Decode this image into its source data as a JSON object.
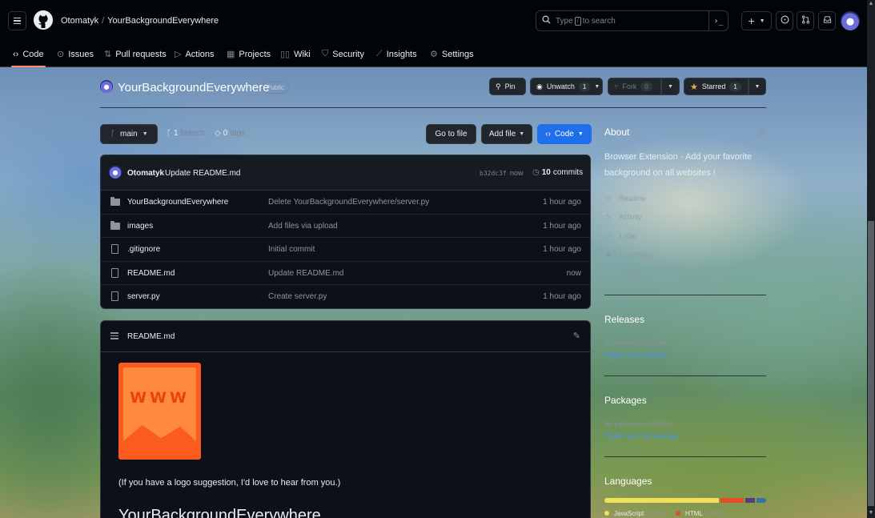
{
  "header": {
    "owner": "Otomatyk",
    "separator": "/",
    "repo": "YourBackgroundEverywhere",
    "search_prefix": "Type",
    "search_key": "/",
    "search_suffix": "to search",
    "cmd_symbol": "›_",
    "plus_symbol": "+"
  },
  "nav": {
    "tabs": [
      {
        "label": "Code",
        "icon": "code-icon"
      },
      {
        "label": "Issues",
        "icon": "issue-icon"
      },
      {
        "label": "Pull requests",
        "icon": "pull-request-icon"
      },
      {
        "label": "Actions",
        "icon": "play-icon"
      },
      {
        "label": "Projects",
        "icon": "table-icon"
      },
      {
        "label": "Wiki",
        "icon": "book-icon"
      },
      {
        "label": "Security",
        "icon": "shield-icon"
      },
      {
        "label": "Insights",
        "icon": "graph-icon"
      },
      {
        "label": "Settings",
        "icon": "gear-icon"
      }
    ],
    "active_tab": "Code",
    "accent_color": "#fd8c73"
  },
  "repo": {
    "title": "YourBackgroundEverywhere",
    "visibility": "Public",
    "pin_label": "Pin",
    "unwatch_label": "Unwatch",
    "unwatch_count": "1",
    "fork_label": "Fork",
    "fork_count": "0",
    "star_label": "Starred",
    "star_count": "1"
  },
  "branch": {
    "name": "main",
    "branch_count": "1",
    "branch_word": "branch",
    "tag_count": "0",
    "tag_word": "tags",
    "go_to_file": "Go to file",
    "add_file": "Add file",
    "code_label": "Code",
    "code_color": "#1f6feb"
  },
  "commit": {
    "author": "Otomatyk",
    "message": "Update README.md",
    "sha": "b32dc3f",
    "time": "now",
    "count": "10",
    "count_word": "commits"
  },
  "files": [
    {
      "name": "YourBackgroundEverywhere",
      "type": "folder",
      "message": "Delete YourBackgroundEverywhere/server.py",
      "time": "1 hour ago"
    },
    {
      "name": "images",
      "type": "folder",
      "message": "Add files via upload",
      "time": "1 hour ago"
    },
    {
      "name": ".gitignore",
      "type": "file",
      "message": "Initial commit",
      "time": "1 hour ago"
    },
    {
      "name": "README.md",
      "type": "file",
      "message": "Update README.md",
      "time": "now"
    },
    {
      "name": "server.py",
      "type": "file",
      "message": "Create server.py",
      "time": "1 hour ago"
    }
  ],
  "readme": {
    "title": "README.md",
    "logo_text": "WWW",
    "paragraph": "(If you have a logo suggestion, I'd love to hear from you.)",
    "heading": "YourBackgroundEverywhere"
  },
  "about": {
    "heading": "About",
    "description": "Browser Extension - Add your favorite background on all websites !",
    "links": [
      {
        "label": "Readme",
        "icon": "book-icon"
      },
      {
        "label": "Activity",
        "icon": "pulse-icon"
      },
      {
        "label": "1 star",
        "icon": "star-icon"
      },
      {
        "label": "1 watching",
        "icon": "eye-icon"
      },
      {
        "label": "0 forks",
        "icon": "fork-icon"
      }
    ]
  },
  "releases": {
    "heading": "Releases",
    "empty": "No releases published",
    "action": "Create a new release"
  },
  "packages": {
    "heading": "Packages",
    "empty": "No packages published",
    "action": "Publish your first package"
  },
  "languages": {
    "heading": "Languages",
    "items": [
      {
        "name": "JavaScript",
        "percent": "72.9%",
        "value": 72.9,
        "color": "#f1e05a"
      },
      {
        "name": "HTML",
        "percent": "14.6%",
        "value": 14.6,
        "color": "#e34c26"
      },
      {
        "name": "",
        "percent": "",
        "value": 6.5,
        "color": "#563d7c"
      },
      {
        "name": "",
        "percent": "",
        "value": 6.0,
        "color": "#3572a5"
      }
    ]
  }
}
